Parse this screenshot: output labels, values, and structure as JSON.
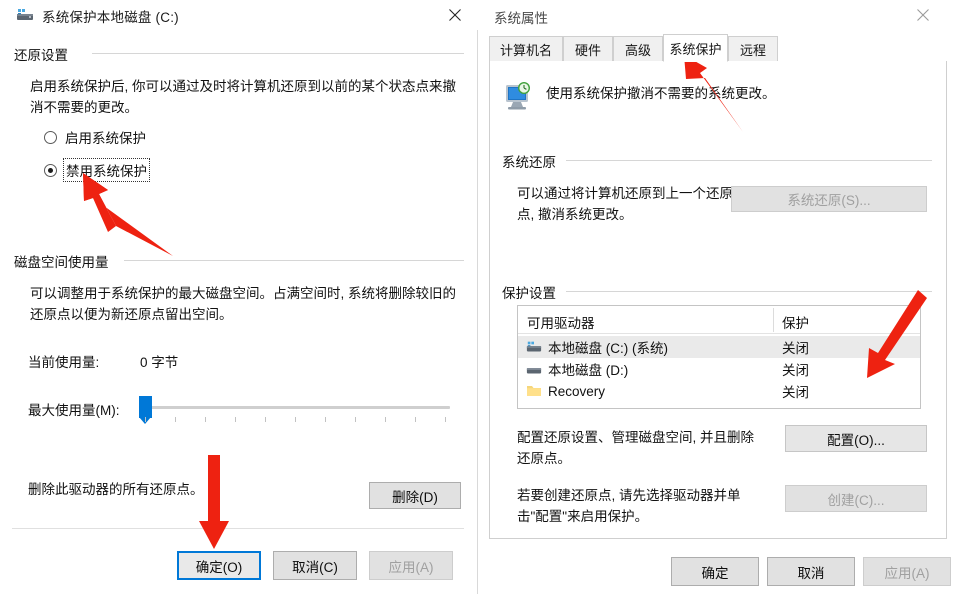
{
  "left_dialog": {
    "title": "系统保护本地磁盘 (C:)",
    "title_icon": "hard-drive-icon",
    "close_label": "✕",
    "restore_settings": {
      "group_title": "还原设置",
      "description": "启用系统保护后, 你可以通过及时将计算机还原到以前的某个状态点来撤消不需要的更改。",
      "options": [
        {
          "label": "启用系统保护",
          "checked": false
        },
        {
          "label": "禁用系统保护",
          "checked": true
        }
      ]
    },
    "disk_usage": {
      "group_title": "磁盘空间使用量",
      "description": "可以调整用于系统保护的最大磁盘空间。占满空间时, 系统将删除较旧的还原点以便为新还原点留出空间。",
      "current_label": "当前使用量:",
      "current_value": "0 字节",
      "max_label": "最大使用量(M):",
      "slider_percent": 1
    },
    "delete_section": {
      "description": "删除此驱动器的所有还原点。",
      "delete_button": "删除(D)"
    },
    "footer": {
      "ok": "确定(O)",
      "cancel": "取消(C)",
      "apply": "应用(A)",
      "apply_disabled": true,
      "ok_focused": true
    }
  },
  "right_window": {
    "title": "系统属性",
    "close_label": "✕",
    "tabs": [
      {
        "label": "计算机名",
        "active": false
      },
      {
        "label": "硬件",
        "active": false
      },
      {
        "label": "高级",
        "active": false
      },
      {
        "label": "系统保护",
        "active": true
      },
      {
        "label": "远程",
        "active": false
      }
    ],
    "header": {
      "icon": "computer-restore-icon",
      "text": "使用系统保护撤消不需要的系统更改。"
    },
    "system_restore": {
      "group_title": "系统还原",
      "description": "可以通过将计算机还原到上一个还原点, 撤消系统更改。",
      "button": "系统还原(S)...",
      "button_disabled": true
    },
    "protection_settings": {
      "group_title": "保护设置",
      "columns": [
        "可用驱动器",
        "保护"
      ],
      "rows": [
        {
          "icon": "hard-drive-system-icon",
          "name": "本地磁盘 (C:) (系统)",
          "protection": "关闭",
          "selected": true
        },
        {
          "icon": "hard-drive-icon",
          "name": "本地磁盘 (D:)",
          "protection": "关闭",
          "selected": false
        },
        {
          "icon": "folder-icon",
          "name": "Recovery",
          "protection": "关闭",
          "selected": false
        }
      ],
      "configure_description": "配置还原设置、管理磁盘空间, 并且删除还原点。",
      "configure_button": "配置(O)...",
      "create_description": "若要创建还原点, 请先选择驱动器并单击\"配置\"来启用保护。",
      "create_button": "创建(C)...",
      "create_disabled": true
    },
    "footer": {
      "ok": "确定",
      "cancel": "取消",
      "apply": "应用(A)",
      "apply_disabled": true
    }
  },
  "annotations": {
    "arrow_color": "#ee2211",
    "arrows": [
      {
        "name": "arrow-to-disable-protection-radio"
      },
      {
        "name": "arrow-to-ok-button"
      },
      {
        "name": "arrow-to-system-protection-tab"
      },
      {
        "name": "arrow-to-configure-button"
      }
    ]
  },
  "watermark": {
    "text": ""
  }
}
